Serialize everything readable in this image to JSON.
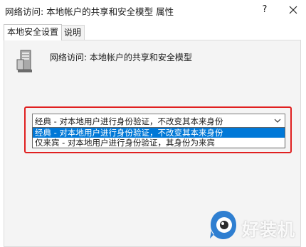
{
  "window": {
    "title": "网络访问: 本地帐户的共享和安全模型 属性",
    "help_label": "?",
    "colors": {
      "accent": "#0078d7",
      "highlight_border": "#e02020",
      "panel_bg": "#f4f4f4"
    }
  },
  "tabs": [
    {
      "label": "本地安全设置",
      "active": true
    },
    {
      "label": "说明",
      "active": false
    }
  ],
  "panel": {
    "icon": "server-icon",
    "policy_name": "网络访问: 本地帐户的共享和安全模型"
  },
  "combo": {
    "value": "经典 - 对本地用户进行身份验证，不改变其本来身份",
    "options": [
      {
        "label": "经典 - 对本地用户进行身份验证，不改变其本来身份",
        "selected": true
      },
      {
        "label": "仅来宾 - 对本地用户进行身份验证，其身份为来宾",
        "selected": false
      }
    ]
  },
  "watermark": {
    "text": "好装机",
    "icon": "watermark-logo-icon"
  }
}
